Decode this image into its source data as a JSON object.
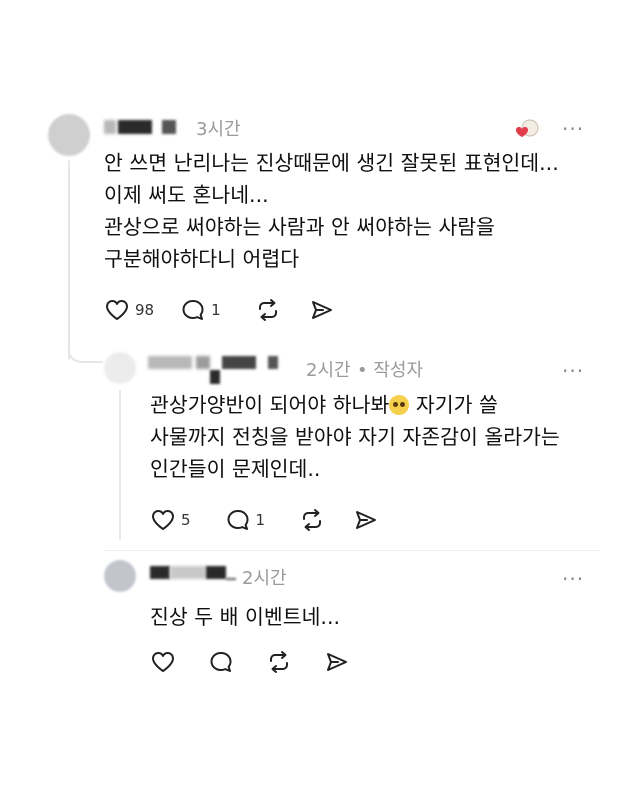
{
  "comments": [
    {
      "time": "3시간",
      "author_tag": "",
      "lines": [
        "안 쓰면 난리나는 진상때문에 생긴 잘못된 표현인데...",
        "이제 써도 혼나네...",
        "관상으로 써야하는 사람과 안 써야하는 사람을",
        "구분해야하다니 어렵다"
      ],
      "likes": "98",
      "replies": "1"
    },
    {
      "time": "2시간",
      "author_tag": "• 작성자",
      "lines": [
        "관상가양반이 되어야 하나봐",
        " 자기가 쓸",
        "사물까지 전칭을 받아야 자기 자존감이 올라가는",
        "인간들이 문제인데.."
      ],
      "likes": "5",
      "replies": "1"
    },
    {
      "time": "2시간",
      "author_tag": "",
      "lines": [
        "진상 두 배 이벤트네..."
      ],
      "likes": "",
      "replies": ""
    }
  ],
  "icons": {
    "like": "heart-icon",
    "reply": "speech-bubble-icon",
    "repost": "repost-icon",
    "share": "send-icon",
    "more": "more-dots-icon"
  },
  "more_glyph": "···",
  "colors": {
    "muted": "#9a9a9a",
    "text": "#101010",
    "line": "#e6e6e6"
  }
}
